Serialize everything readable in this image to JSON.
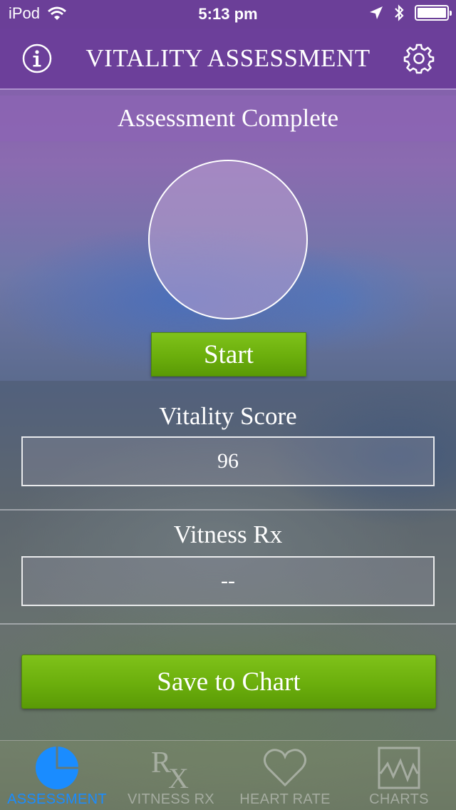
{
  "status_bar": {
    "carrier": "iPod",
    "time": "5:13 pm"
  },
  "header": {
    "title": "VITALITY ASSESSMENT"
  },
  "banner": {
    "text": "Assessment Complete"
  },
  "start_button": {
    "label": "Start"
  },
  "vitality_score": {
    "label": "Vitality Score",
    "value": "96"
  },
  "vitness_rx": {
    "label": "Vitness Rx",
    "value": "--"
  },
  "save_button": {
    "label": "Save to Chart"
  },
  "tabs": [
    {
      "label": "ASSESSMENT",
      "icon": "pie-chart-icon",
      "active": true
    },
    {
      "label": "VITNESS RX",
      "icon": "rx-icon",
      "active": false
    },
    {
      "label": "HEART RATE",
      "icon": "heart-icon",
      "active": false
    },
    {
      "label": "CHARTS",
      "icon": "line-chart-icon",
      "active": false
    }
  ],
  "colors": {
    "header": "#6c3f9a",
    "button_green": "#6bae0c",
    "active_tab": "#1a8cff"
  }
}
